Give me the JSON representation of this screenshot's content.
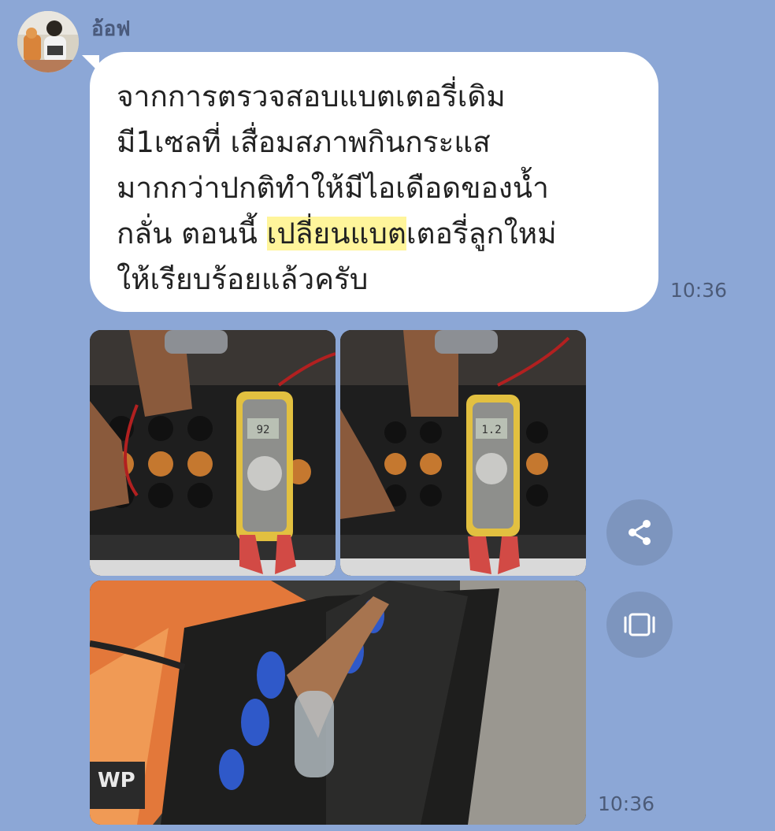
{
  "sender": {
    "name": "อ้อฟ"
  },
  "message": {
    "lines": {
      "l1": "จากการตรวจสอบแบตเตอรี่เดิม",
      "l2": "มี1เซลที่ เสื่อมสภาพกินกระแส",
      "l3": "มากกว่าปกติทำให้มีไอเดือดของน้ำ",
      "l4a": "กลั่น ตอนนี้ ",
      "l4b": "เปลี่ยนแบต",
      "l4c": "เตอรี่ลูกใหม่",
      "l5": "ให้เรียบร้อยแล้วครับ"
    },
    "time": "10:36",
    "highlight_color": "#fff59b"
  },
  "photos": {
    "time": "10:36",
    "meter1_reading": "92",
    "meter2_reading": "1.2"
  },
  "actions": {
    "share_icon": "share-icon",
    "expand_icon": "expand-icon"
  },
  "colors": {
    "background": "#8ca7d6",
    "bubble": "#ffffff",
    "button": "#7d95be"
  }
}
